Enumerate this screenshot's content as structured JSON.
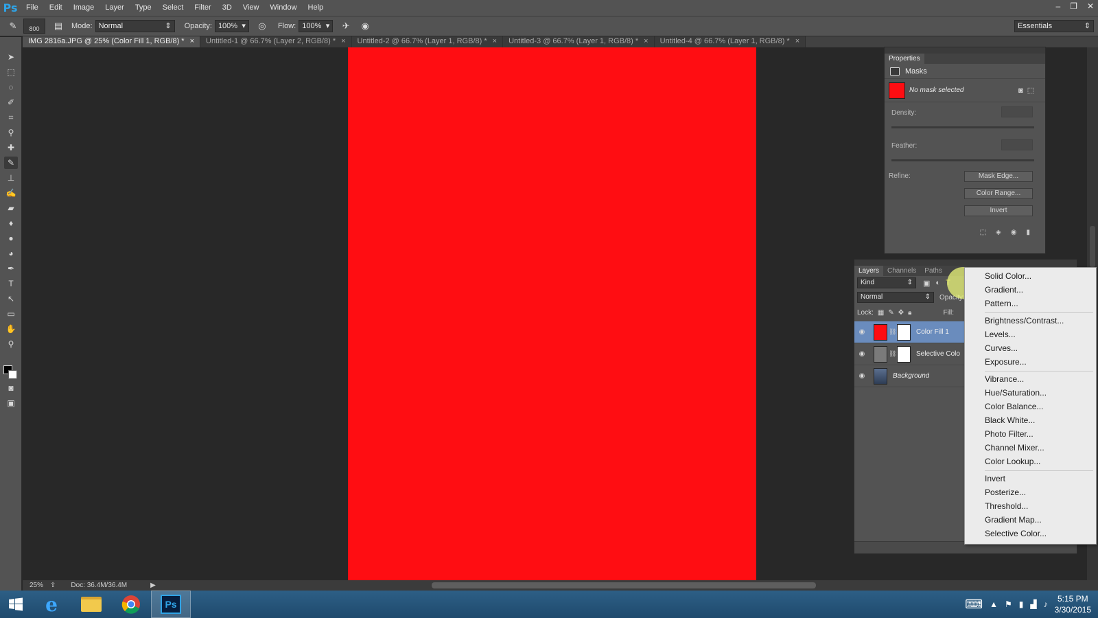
{
  "menubar": {
    "logo": "Ps",
    "items": [
      "File",
      "Edit",
      "Image",
      "Layer",
      "Type",
      "Select",
      "Filter",
      "3D",
      "View",
      "Window",
      "Help"
    ],
    "controls": [
      "‒",
      "❐",
      "✕"
    ]
  },
  "options": {
    "brush_size": "800",
    "mode_label": "Mode:",
    "mode_value": "Normal",
    "opacity_label": "Opacity:",
    "opacity_value": "100%",
    "flow_label": "Flow:",
    "flow_value": "100%",
    "workspace": "Essentials"
  },
  "tabs": [
    {
      "label": "IMG 2816a.JPG @ 25% (Color Fill 1, RGB/8) *",
      "close": "×"
    },
    {
      "label": "Untitled-1 @ 66.7% (Layer 2, RGB/8) *",
      "close": "×"
    },
    {
      "label": "Untitled-2 @ 66.7% (Layer 1, RGB/8) *",
      "close": "×"
    },
    {
      "label": "Untitled-3 @ 66.7% (Layer 1, RGB/8) *",
      "close": "×"
    },
    {
      "label": "Untitled-4 @ 66.7% (Layer 1, RGB/8) *",
      "close": "×"
    }
  ],
  "document": {
    "fill_color": "#ff0d12"
  },
  "status": {
    "zoom": "25%",
    "doc": "Doc: 36.4M/36.4M"
  },
  "properties": {
    "tab": "Properties",
    "section": "Masks",
    "mask_status": "No mask selected",
    "density_label": "Density:",
    "feather_label": "Feather:",
    "refine_label": "Refine:",
    "buttons": [
      "Mask Edge...",
      "Color Range...",
      "Invert"
    ]
  },
  "layers": {
    "tabs": [
      "Layers",
      "Channels",
      "Paths"
    ],
    "filter": "Kind",
    "blend_mode": "Normal",
    "opacity_label": "Opacity:",
    "lock_label": "Lock:",
    "fill_label": "Fill:",
    "items": [
      {
        "name": "Color Fill 1",
        "selected": true
      },
      {
        "name": "Selective Colo",
        "selected": false
      },
      {
        "name": "Background",
        "selected": false
      }
    ]
  },
  "context_menu": {
    "groups": [
      [
        "Solid Color...",
        "Gradient...",
        "Pattern..."
      ],
      [
        "Brightness/Contrast...",
        "Levels...",
        "Curves...",
        "Exposure..."
      ],
      [
        "Vibrance...",
        "Hue/Saturation...",
        "Color Balance...",
        "Black  White...",
        "Photo Filter...",
        "Channel Mixer...",
        "Color Lookup..."
      ],
      [
        "Invert",
        "Posterize...",
        "Threshold...",
        "Gradient Map...",
        "Selective Color..."
      ]
    ]
  },
  "taskbar": {
    "time": "5:15 PM",
    "date": "3/30/2015",
    "ps_label": "Ps"
  },
  "colors": {
    "accent": "#2fa3e6",
    "selection": "#6a8cbd",
    "highlight": "#e6f078"
  }
}
